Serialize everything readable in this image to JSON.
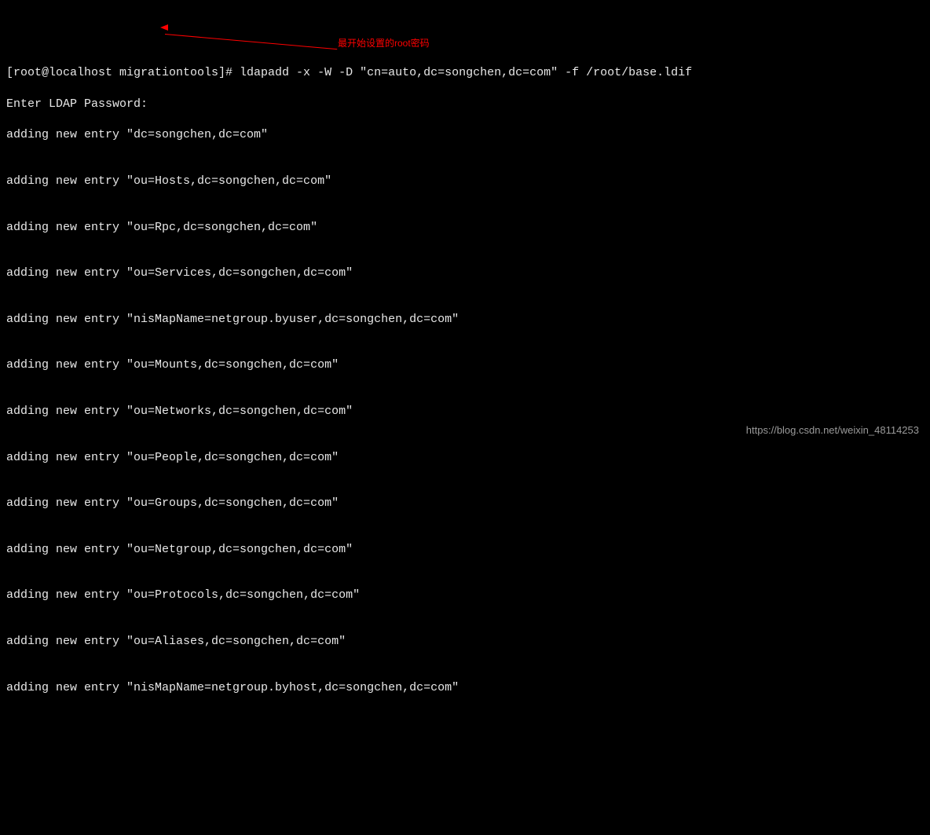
{
  "prompt_line": "[root@localhost migrationtools]# ldapadd -x -W -D \"cn=auto,dc=songchen,dc=com\" -f /root/base.ldif",
  "pw_line": "Enter LDAP Password:",
  "first_entry": "adding new entry \"dc=songchen,dc=com\"",
  "entries": [
    "adding new entry \"ou=Hosts,dc=songchen,dc=com\"",
    "adding new entry \"ou=Rpc,dc=songchen,dc=com\"",
    "adding new entry \"ou=Services,dc=songchen,dc=com\"",
    "adding new entry \"nisMapName=netgroup.byuser,dc=songchen,dc=com\"",
    "adding new entry \"ou=Mounts,dc=songchen,dc=com\"",
    "adding new entry \"ou=Networks,dc=songchen,dc=com\"",
    "adding new entry \"ou=People,dc=songchen,dc=com\"",
    "adding new entry \"ou=Groups,dc=songchen,dc=com\"",
    "adding new entry \"ou=Netgroup,dc=songchen,dc=com\"",
    "adding new entry \"ou=Protocols,dc=songchen,dc=com\"",
    "adding new entry \"ou=Aliases,dc=songchen,dc=com\"",
    "adding new entry \"nisMapName=netgroup.byhost,dc=songchen,dc=com\""
  ],
  "annotation": "最开始设置的root密码",
  "watermark": "https://blog.csdn.net/weixin_48114253"
}
